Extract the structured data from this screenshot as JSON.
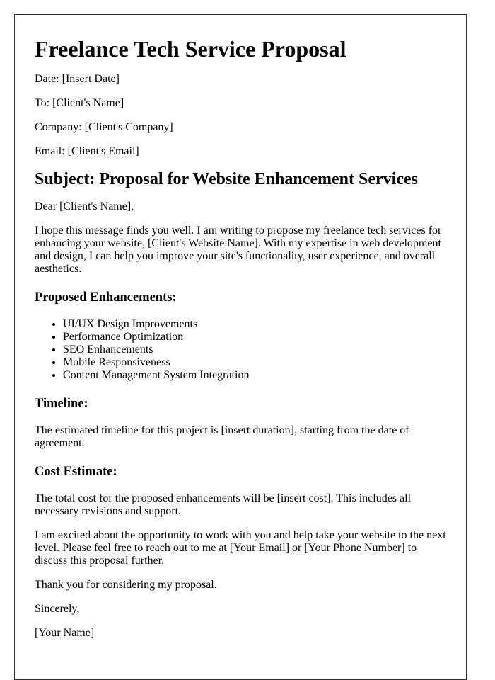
{
  "title": "Freelance Tech Service Proposal",
  "header_fields": [
    "Date: [Insert Date]",
    "To: [Client's Name]",
    "Company: [Client's Company]",
    "Email: [Client's Email]"
  ],
  "subject": "Subject: Proposal for Website Enhancement Services",
  "salutation": "Dear [Client's Name],",
  "intro": "I hope this message finds you well. I am writing to propose my freelance tech services for enhancing your website, [Client's Website Name]. With my expertise in web development and design, I can help you improve your site's functionality, user experience, and overall aesthetics.",
  "enhancements": {
    "heading": "Proposed Enhancements:",
    "items": [
      "UI/UX Design Improvements",
      "Performance Optimization",
      "SEO Enhancements",
      "Mobile Responsiveness",
      "Content Management System Integration"
    ]
  },
  "timeline": {
    "heading": "Timeline:",
    "text": "The estimated timeline for this project is [insert duration], starting from the date of agreement."
  },
  "cost": {
    "heading": "Cost Estimate:",
    "text": "The total cost for the proposed enhancements will be [insert cost]. This includes all necessary revisions and support."
  },
  "closing_paragraph": "I am excited about the opportunity to work with you and help take your website to the next level. Please feel free to reach out to me at [Your Email] or [Your Phone Number] to discuss this proposal further.",
  "thanks": "Thank you for considering my proposal.",
  "signoff": "Sincerely,",
  "signature": "[Your Name]"
}
